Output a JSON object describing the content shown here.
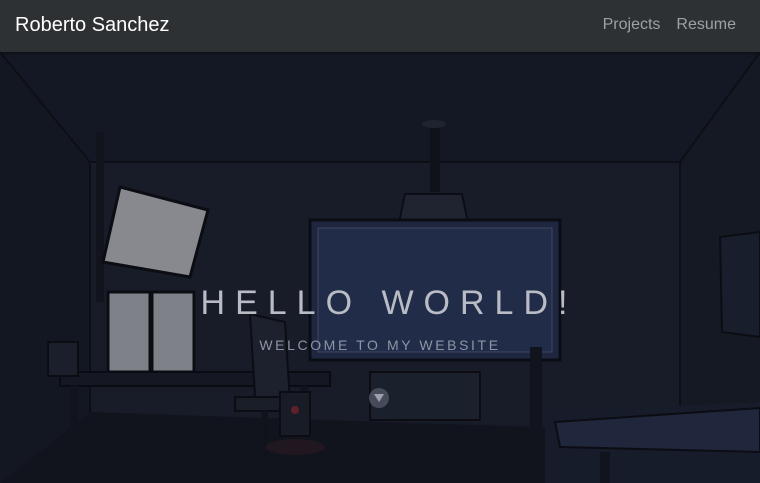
{
  "navbar": {
    "brand": "Roberto Sanchez",
    "links": [
      {
        "label": "Projects"
      },
      {
        "label": "Resume"
      }
    ]
  },
  "hero": {
    "title": "HELLO WORLD!",
    "subtitle": "WELCOME TO MY WEBSITE",
    "scroll_icon": "chevron-down-icon"
  },
  "colors": {
    "navbar_bg": "#2e3133",
    "brand_text": "#ffffff",
    "nav_link_text": "#9da1a5",
    "hero_bg": "#1c2130"
  }
}
